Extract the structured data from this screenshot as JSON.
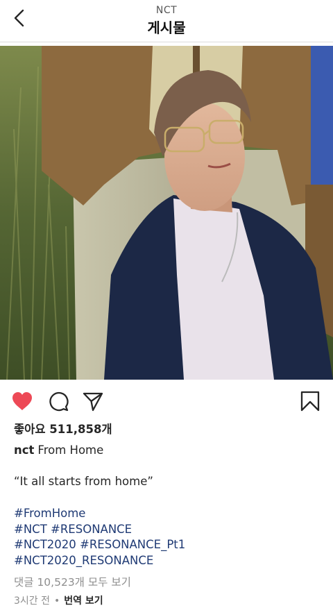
{
  "header": {
    "account": "NCT",
    "title": "게시물"
  },
  "post": {
    "likes_text": "좋아요 511,858개",
    "username": "nct",
    "caption_text": "From Home",
    "quote": "“It all starts from home”",
    "hashtag_lines": [
      "#FromHome",
      "#NCT #RESONANCE",
      "#NCT2020 #RESONANCE_Pt1",
      "#NCT2020_RESONANCE"
    ],
    "view_comments": "댓글 10,523개 모두 보기",
    "time_ago": "3시간 전",
    "separator": "•",
    "translate": "번역 보기"
  },
  "icons": {
    "back": "chevron-left-icon",
    "like": "heart-filled-icon",
    "comment": "comment-bubble-icon",
    "share": "send-paper-plane-icon",
    "save": "bookmark-icon"
  },
  "colors": {
    "like_red": "#ed4956",
    "hashtag_blue": "#1f3a74",
    "muted_gray": "#8e8e8e"
  }
}
